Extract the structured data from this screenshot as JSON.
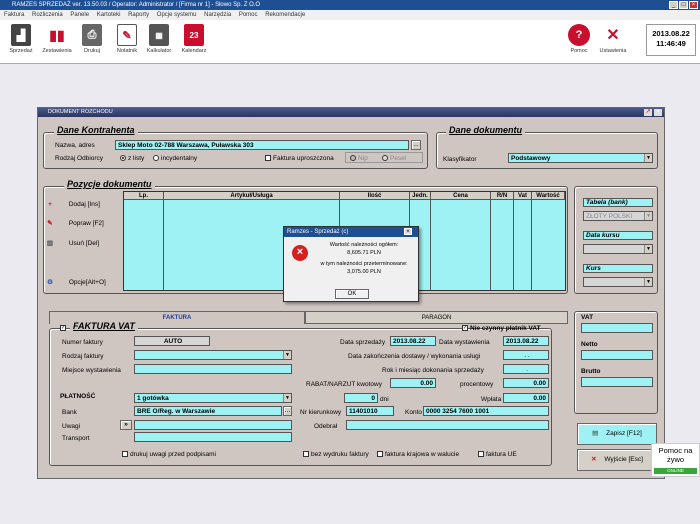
{
  "app": {
    "title": "RAMZES SPRZEDAŻ ver. 13.50.03 /   Operator: Administrator /   [Firma nr 1] - Słowo Sp. Z O.O",
    "menu": [
      "Faktura",
      "Rozliczenia",
      "Panele",
      "Kartoteki",
      "Raporty",
      "Opcje systemu",
      "Narzędzia",
      "Pomoc",
      "Rekomendacje"
    ]
  },
  "toolbar": {
    "left": [
      {
        "label": "Sprzedaż",
        "icon": "shopping-bag-icon",
        "color": "#c8102e"
      },
      {
        "label": "Zestawienia",
        "icon": "bar-chart-icon",
        "color": "#c8102e"
      },
      {
        "label": "Drukuj",
        "icon": "printer-icon",
        "color": "#c8102e"
      },
      {
        "label": "Notatnik",
        "icon": "notepad-icon",
        "color": "#c8102e"
      },
      {
        "label": "Kalkulator",
        "icon": "calculator-icon",
        "color": "#c8102e"
      },
      {
        "label": "Kalendarz",
        "icon": "calendar-icon",
        "color": "#c8102e"
      }
    ],
    "right": [
      {
        "label": "Pomoc",
        "icon": "help-icon"
      },
      {
        "label": "Ustawienia",
        "icon": "tools-icon"
      }
    ],
    "calendar_day": "23"
  },
  "clock": {
    "date": "2013.08.22",
    "time": "11:46:49"
  },
  "window": {
    "title": "DOKUMENT ROZCHODU"
  },
  "kontrahent": {
    "title": "Dane Kontrahenta",
    "name_label": "Nazwa, adres",
    "name_value": "Sklep Moto 02-788 Warszawa, Puławska 303",
    "ellipsis": "...",
    "rodzaj_label": "Rodzaj Odbiorcy",
    "opt_list": "z listy",
    "opt_incydentalny": "incydentalny",
    "faktura_upr": "Faktura uproszczona",
    "opt_nip": "Nip",
    "opt_pesel": "Pesel"
  },
  "dokument": {
    "title": "Dane dokumentu",
    "klasyfikator_label": "Klasyfikator",
    "klasyfikator_value": "Podstawowy"
  },
  "pozycje": {
    "title": "Pozycje dokumentu",
    "buttons": [
      {
        "label": "Dodaj  [Ins]",
        "icon": "plus-icon"
      },
      {
        "label": "Popraw  [F2]",
        "icon": "pencil-icon"
      },
      {
        "label": "Usuń  [Del]",
        "icon": "trash-icon"
      },
      {
        "label": "Opcje[Alt+O]",
        "icon": "gear-icon"
      }
    ],
    "columns": [
      "Lp.",
      "Artykuł/Usługa",
      "Ilość",
      "Jedn.",
      "Cena",
      "R/N",
      "Vat",
      "Wartość"
    ]
  },
  "side_panel": {
    "tabela_label": "Tabela (bank)",
    "tabela_value": "ZŁOTY POLSKI",
    "kurs_date_label": "Data kursu",
    "kurs_label": "Kurs",
    "vat_label": "VAT",
    "netto_label": "Netto",
    "brutto_label": "Brutto"
  },
  "tabs": {
    "faktura": "FAKTURA",
    "paragon": "PARAGON"
  },
  "faktura": {
    "title": "FAKTURA VAT",
    "czynny": "Nie czynny płatnik VAT",
    "numer_label": "Numer faktury",
    "numer_value": "AUTO",
    "rodzaj_label": "Rodzaj faktury",
    "miejsce_label": "Miejsce wystawienia",
    "data_sprzedazy_label": "Data sprzedaży",
    "data_sprzedazy": "2013.08.22",
    "data_wystawienia_label": "Data wystawienia",
    "data_wystawienia": "2013.08.22",
    "data_zak_label": "Data zakończenia dostawy / wykonania usługi",
    "data_zak_value": ". .",
    "rok_label": "Rok i miesiąc dokonania sprzedaży",
    "rok_value": ".",
    "rabat_label": "RABAT/NARZUT  kwotowy",
    "rabat_value": "0.00",
    "procentowy_label": "procentowy",
    "procentowy_value": "0.00",
    "platnosc_label": "PŁATNOŚĆ",
    "platnosc_value": "1 gotówka",
    "dni_value": "0",
    "dni_label": "dni",
    "wplata_label": "Wpłata",
    "wplata_value": "0.00",
    "bank_label": "Bank",
    "bank_value": "BRE O/Reg. w Warszawie",
    "nr_kier_label": "Nr kierunkowy",
    "nr_kier_value": "11401010",
    "konto_label": "Konto",
    "konto_value": "0000 3254 7600 1001",
    "uwagi_label": "Uwagi",
    "uwagi_btn": "»",
    "odebral_label": "Odebrał",
    "transport_label": "Transport",
    "cb_drukuj": "drukuj uwagi przed podpisami",
    "cb_bez": "bez wydruku faktury",
    "cb_krajowa": "faktura krajowa w walucie",
    "cb_ue": "faktura UE"
  },
  "actions": {
    "zapisz": "Zapisz  [F12]",
    "wyjscie": "Wyjście  [Esc]"
  },
  "dialog": {
    "title": "Ramzes - Sprzedaż (c)",
    "line1": "Wartość należności ogółem:",
    "line2": "8,605.71 PLN",
    "line3": "w tym należności przeterminowane:",
    "line4": "3,075.00 PLN",
    "ok": "OK"
  },
  "pomoc": {
    "line1": "Pomoc na",
    "line2": "żywo",
    "status": "ONLINE"
  }
}
